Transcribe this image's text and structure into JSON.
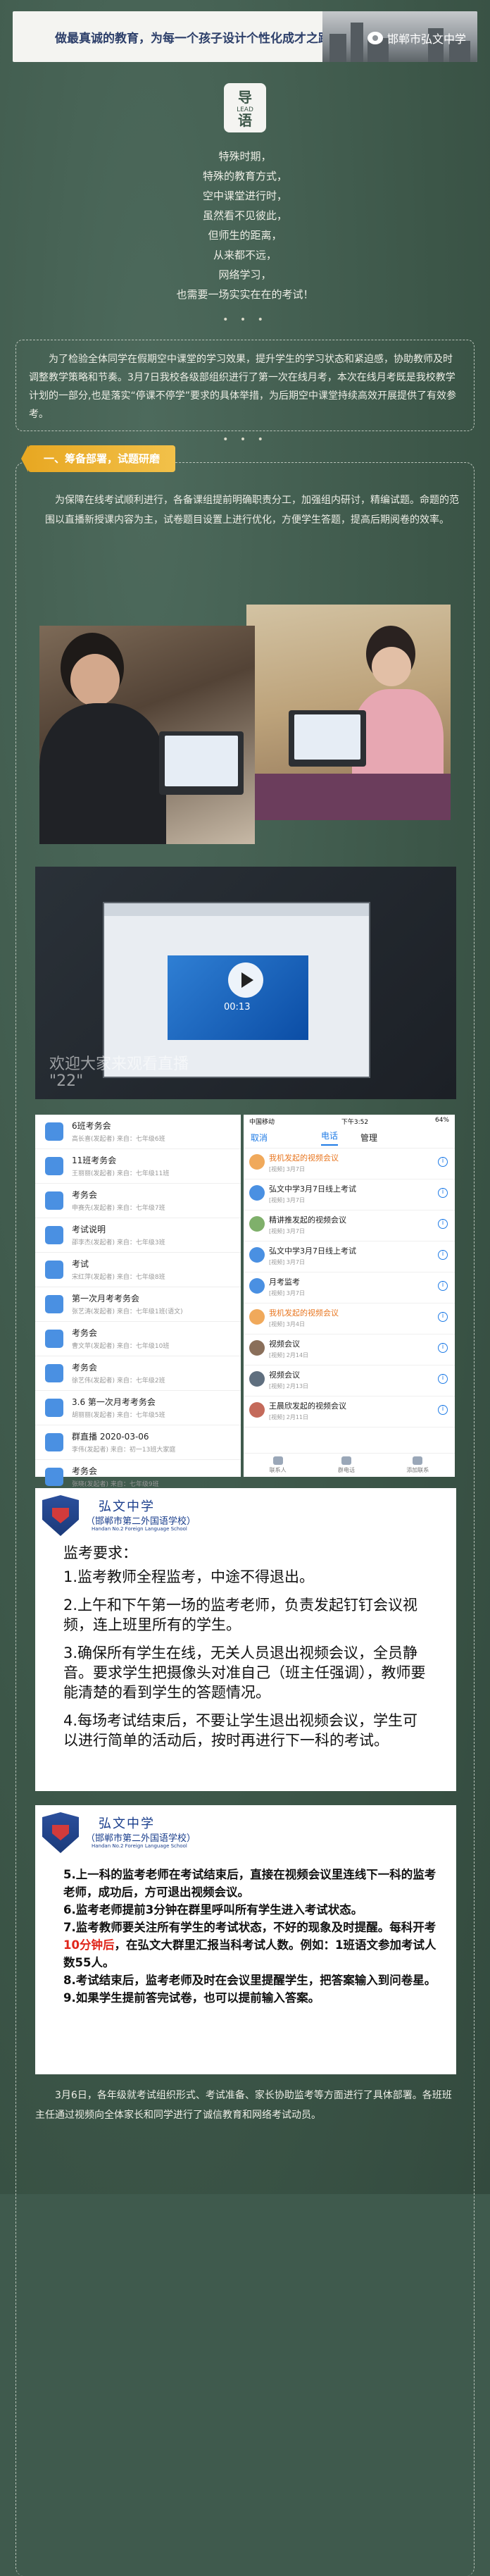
{
  "header": {
    "motto": "做最真诚的教育，为每一个孩子设计个性化成才之路。",
    "brand": "邯郸市弘文中学"
  },
  "lead": {
    "top": "导",
    "en": "LEAD",
    "bottom": "语"
  },
  "poem": [
    "特殊时期，",
    "特殊的教育方式，",
    "空中课堂进行时，",
    "虽然看不见彼此，",
    "但师生的距离，",
    "从来都不远，",
    "网络学习，",
    "也需要一场实实在在的考试！"
  ],
  "intro": "为了检验全体同学在假期空中课堂的学习效果，提升学生的学习状态和紧迫感，协助教师及时调整教学策略和节奏。3月7日我校各级部组织进行了第一次在线月考，本次在线月考既是我校教学计划的一部分,也是落实“停课不停学”要求的具体举措，为后期空中课堂持续高效开展提供了有效参考。",
  "section": {
    "title": "一、筹备部署，试题研磨",
    "text": "为保障在线考试顺利进行，各备课组提前明确职责分工，加强组内研讨，精编试题。命题的范围以直播新授课内容为主，试卷题目设置上进行优化，方便学生答题，提高后期阅卷的效率。"
  },
  "video": {
    "time": "00:13",
    "line1": "欢迎大家来观看直播",
    "line2": "\"22\""
  },
  "app_left": {
    "items": [
      {
        "title": "6班考务会",
        "sub": "高长喜(发起者)  来自：七年级6班",
        "date": ""
      },
      {
        "title": "11班考务会",
        "sub": "王丽丽(发起者)  来自：七年级11班",
        "date": ""
      },
      {
        "title": "考务会",
        "sub": "申赛先(发起者)  来自：七年级7班",
        "date": ""
      },
      {
        "title": "考试说明",
        "sub": "邵李杰(发起者)  来自：七年级3班",
        "date": ""
      },
      {
        "title": "考试",
        "sub": "宋红萍(发起者)  来自：七年级8班",
        "date": ""
      },
      {
        "title": "第一次月考考务会",
        "sub": "张艺涛(发起者)  来自：七年级1班(语文)",
        "date": ""
      },
      {
        "title": "考务会",
        "sub": "曹文苹(发起者)  来自：七年级10班",
        "date": ""
      },
      {
        "title": "考务会",
        "sub": "徐艺伟(发起者)  来自：七年级2班",
        "date": ""
      },
      {
        "title": "3.6  第一次月考考务会",
        "sub": "胡丽丽(发起者)  来自：七年级5班",
        "date": ""
      },
      {
        "title": "群直播 2020-03-06",
        "sub": "李伟(发起者)  来自：初一13班大家庭",
        "date": ""
      },
      {
        "title": "考务会",
        "sub": "张晓(发起者)  来自：七年级9班",
        "date": ""
      }
    ]
  },
  "app_right": {
    "status_left": "中国移动",
    "status_time": "下午3:52",
    "status_right": "64%",
    "cancel": "取消",
    "tab_phone": "电话",
    "tab_manage": "管理",
    "items": [
      {
        "title": "我机发起的视频会议",
        "sub": "[视频] 3月7日",
        "orange": true
      },
      {
        "title": "弘文中学3月7日线上考试",
        "sub": "[视频] 3月7日",
        "orange": false
      },
      {
        "title": "精讲推发起的视频会议",
        "sub": "[视频] 3月7日",
        "orange": false
      },
      {
        "title": "弘文中学3月7日线上考试",
        "sub": "[视频] 3月7日",
        "orange": false
      },
      {
        "title": "月考监考",
        "sub": "[视频] 3月7日",
        "orange": false
      },
      {
        "title": "我机发起的视频会议",
        "sub": "[视频] 3月4日",
        "orange": true
      },
      {
        "title": "视频会议",
        "sub": "[视频] 2月14日",
        "orange": false
      },
      {
        "title": "视频会议",
        "sub": "[视频] 2月13日",
        "orange": false
      },
      {
        "title": "王晨欣发起的视频会议",
        "sub": "[视频] 2月11日",
        "orange": false
      }
    ],
    "tabbar": [
      "联系人",
      "群电话",
      "添加联系"
    ]
  },
  "school": {
    "name": "弘文中学",
    "full": "（邯郸市第二外国语学校）",
    "en": "Handan No.2 Foreign Language School"
  },
  "notice1": {
    "heading": "监考要求：",
    "items": [
      "1.监考教师全程监考，中途不得退出。",
      "2.上午和下午第一场的监考老师，负责发起钉钉会议视频，连上班里所有的学生。",
      "3.确保所有学生在线，无关人员退出视频会议，全员静音。要求学生把摄像头对准自己（班主任强调），教师要能清楚的看到学生的答题情况。",
      "4.每场考试结束后，不要让学生退出视频会议，学生可以进行简单的活动后，按时再进行下一科的考试。"
    ]
  },
  "notice2": {
    "i5": "5.上一科的监考老师在考试结束后，直接在视频会议里连线下一科的监考老师，成功后，方可退出视频会议。",
    "i6": "6.监考老师提前3分钟在群里呼叫所有学生进入考试状态。",
    "i7a": "7.监考教师要关注所有学生的考试状态，不好的现象及时提醒。每科开考",
    "i7red": "10分钟后",
    "i7b": "，在弘文大群里汇报当科考试人数。例如：1班语文参加考试人数55人。",
    "i8": "8.考试结束后，监考老师及时在会议里提醒学生，把答案输入到问卷星。",
    "i9": "9.如果学生提前答完试卷，也可以提前输入答案。"
  },
  "footer": "3月6日，各年级就考试组织形式、考试准备、家长协助监考等方面进行了具体部署。各班班主任通过视频向全体家长和同学进行了诚信教育和网络考试动员。"
}
